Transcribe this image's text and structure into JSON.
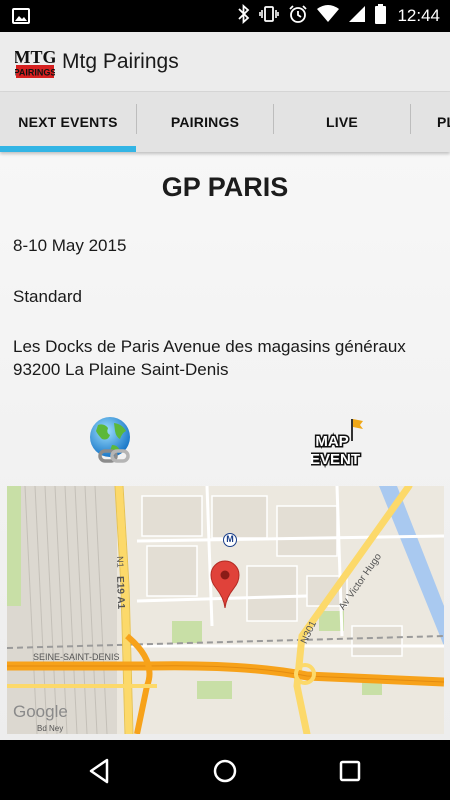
{
  "status_bar": {
    "time": "12:44",
    "icons": [
      "image-icon",
      "bluetooth-icon",
      "vibrate-icon",
      "alarm-icon",
      "wifi-icon",
      "cell-signal-icon",
      "battery-icon"
    ]
  },
  "app_bar": {
    "logo_text_top": "MTG",
    "logo_text_bottom": "PAIRINGS",
    "title": "Mtg Pairings"
  },
  "tabs": [
    {
      "label": "NEXT EVENTS",
      "selected": true
    },
    {
      "label": "PAIRINGS",
      "selected": false
    },
    {
      "label": "LIVE",
      "selected": false
    },
    {
      "label": "PL",
      "selected": false
    }
  ],
  "event": {
    "title": "GP PARIS",
    "date": "8-10 May 2015",
    "format": "Standard",
    "address": "Les Docks de Paris Avenue des magasins généraux 93200 La Plaine Saint-Denis"
  },
  "actions": {
    "map_event_line1": "MAP",
    "map_event_line2": "EVENT"
  },
  "map": {
    "labels": {
      "n1": "N1",
      "e19": "E19 A1",
      "victor_hugo": "Av Victor Hugo",
      "n301": "N301",
      "seine": "SEINE-SAINT-DENIS",
      "bd_ney": "Bd Ney",
      "metro": "M"
    },
    "google": "Google"
  },
  "colors": {
    "tab_indicator": "#33b5e5",
    "marker": "#e0423a",
    "highway": "#f7a21a",
    "road_yellow": "#fcd96a",
    "park": "#c8dfa6"
  }
}
